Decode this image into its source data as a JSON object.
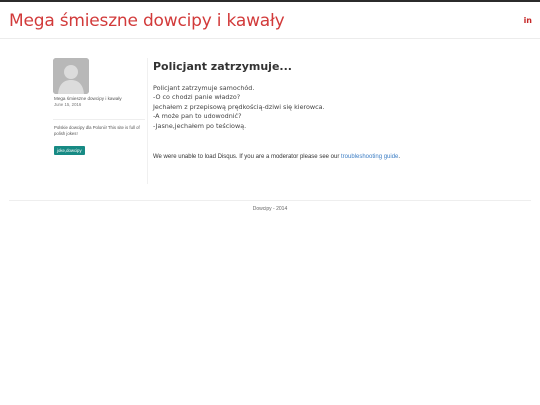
{
  "header": {
    "site_title": "Mega śmieszne dowcipy i kawały",
    "social_icon_label": "in",
    "social_icon": "linkedin-icon"
  },
  "sidebar": {
    "avatar_icon": "user-avatar-placeholder",
    "author_name": "Mega śmieszne dowcipy i kawały",
    "date": "June 15, 2016",
    "bio": "Polskie dowcipy dla Polonii! This site is full of polish jokes!",
    "tag": "joke,dowcipy"
  },
  "post": {
    "title": "Policjant zatrzymuje...",
    "lines": [
      "Policjant zatrzymuje samochód.",
      "-O co chodzi panie władzo?",
      "Jechałem z przepisową prędkością-dziwi się kierowca.",
      "-A może pan to udowodnić?",
      "-Jasne,jechałem po teściową."
    ]
  },
  "disqus": {
    "message": "We were unable to load Disqus. If you are a moderator please see our ",
    "link": "troubleshooting guide",
    "end": "."
  },
  "footer": {
    "text": "Dowcipy - 2014"
  },
  "colors": {
    "title": "#d23a3a",
    "linkedin": "#c62828",
    "tag_bg": "#178a84",
    "link": "#3b7dc4"
  }
}
